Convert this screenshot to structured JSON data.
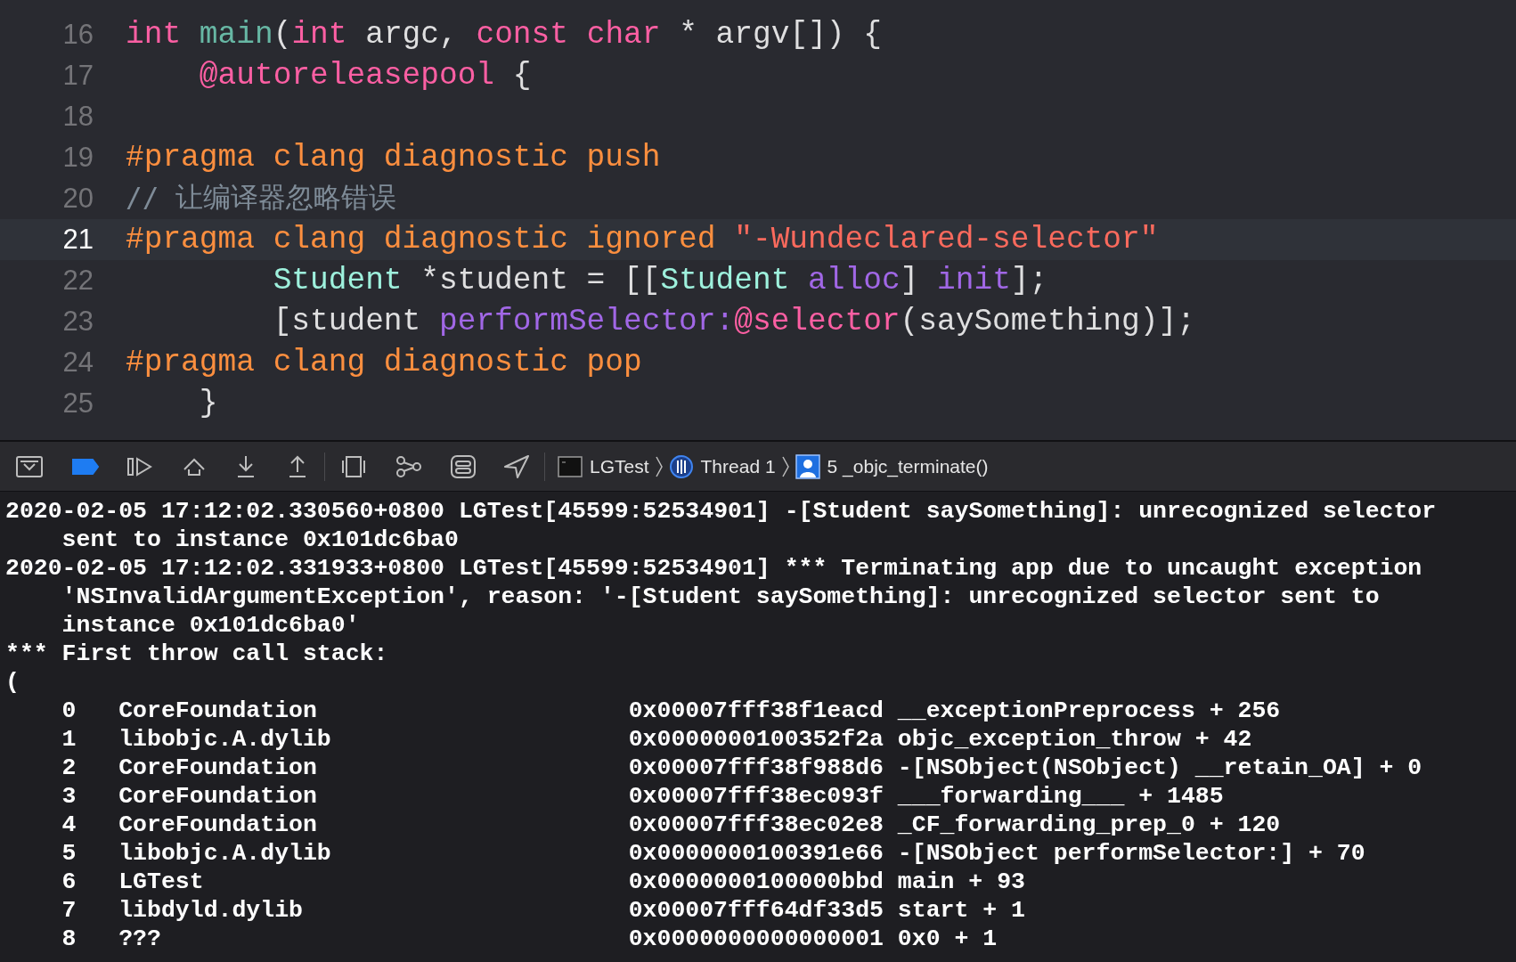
{
  "editor": {
    "lines": [
      {
        "number": "16",
        "current": false,
        "tokens": [
          {
            "kind": "keyword",
            "text": "int"
          },
          {
            "kind": "function",
            "text": " main"
          },
          {
            "kind": "plain",
            "text": "("
          },
          {
            "kind": "keyword",
            "text": "int"
          },
          {
            "kind": "plain",
            "text": " argc, "
          },
          {
            "kind": "keyword",
            "text": "const"
          },
          {
            "kind": "keyword",
            "text": " char"
          },
          {
            "kind": "plain",
            "text": " * argv[]) {"
          }
        ]
      },
      {
        "number": "17",
        "current": false,
        "tokens": [
          {
            "kind": "keyword",
            "text": "    @autoreleasepool"
          },
          {
            "kind": "plain",
            "text": " {"
          }
        ]
      },
      {
        "number": "18",
        "current": false
      },
      {
        "number": "19",
        "current": false,
        "tokens": [
          {
            "kind": "preprocessor",
            "text": "#pragma clang diagnostic push"
          }
        ]
      },
      {
        "number": "20",
        "current": false,
        "tokens": [
          {
            "kind": "comment",
            "text": "// 让编译器忽略错误"
          }
        ]
      },
      {
        "number": "21",
        "current": true,
        "tokens": [
          {
            "kind": "preprocessor",
            "text": "#pragma clang diagnostic ignored "
          },
          {
            "kind": "string",
            "text": "\"-Wundeclared-selector\""
          }
        ]
      },
      {
        "number": "22",
        "current": false,
        "tokens": [
          {
            "kind": "type",
            "text": "        Student"
          },
          {
            "kind": "plain",
            "text": " *student = [["
          },
          {
            "kind": "type",
            "text": "Student"
          },
          {
            "kind": "method",
            "text": " alloc"
          },
          {
            "kind": "plain",
            "text": "] "
          },
          {
            "kind": "method",
            "text": "init"
          },
          {
            "kind": "plain",
            "text": "];"
          }
        ]
      },
      {
        "number": "23",
        "current": false,
        "tokens": [
          {
            "kind": "plain",
            "text": "        [student "
          },
          {
            "kind": "method",
            "text": "performSelector:"
          },
          {
            "kind": "keyword",
            "text": "@selector"
          },
          {
            "kind": "plain",
            "text": "(saySomething)];"
          }
        ]
      },
      {
        "number": "24",
        "current": false,
        "tokens": [
          {
            "kind": "preprocessor",
            "text": "#pragma clang diagnostic pop"
          }
        ]
      },
      {
        "number": "25",
        "current": false,
        "tokens": [
          {
            "kind": "plain",
            "text": "    }"
          }
        ]
      }
    ]
  },
  "debug_bar": {
    "breakpoints_active": true,
    "breadcrumb": [
      {
        "kind": "process",
        "label": "LGTest"
      },
      {
        "kind": "thread",
        "label": "Thread 1"
      },
      {
        "kind": "frame",
        "label": "5 _objc_terminate()"
      }
    ]
  },
  "console": {
    "messages": [
      {
        "lines": [
          "2020-02-05 17:12:02.330560+0800 LGTest[45599:52534901] -[Student saySomething]: unrecognized selector",
          "sent to instance 0x101dc6ba0"
        ]
      },
      {
        "lines": [
          "2020-02-05 17:12:02.331933+0800 LGTest[45599:52534901] *** Terminating app due to uncaught exception",
          "'NSInvalidArgumentException', reason: '-[Student saySomething]: unrecognized selector sent to",
          "instance 0x101dc6ba0'"
        ]
      },
      {
        "lines": [
          "*** First throw call stack:"
        ]
      },
      {
        "lines": [
          "("
        ]
      }
    ],
    "frames": [
      {
        "index": "0",
        "library": "CoreFoundation",
        "address": "0x00007fff38f1eacd",
        "symbol": "__exceptionPreprocess + 256"
      },
      {
        "index": "1",
        "library": "libobjc.A.dylib",
        "address": "0x0000000100352f2a",
        "symbol": "objc_exception_throw + 42"
      },
      {
        "index": "2",
        "library": "CoreFoundation",
        "address": "0x00007fff38f988d6",
        "symbol": "-[NSObject(NSObject) __retain_OA] + 0"
      },
      {
        "index": "3",
        "library": "CoreFoundation",
        "address": "0x00007fff38ec093f",
        "symbol": "___forwarding___ + 1485"
      },
      {
        "index": "4",
        "library": "CoreFoundation",
        "address": "0x00007fff38ec02e8",
        "symbol": "_CF_forwarding_prep_0 + 120"
      },
      {
        "index": "5",
        "library": "libobjc.A.dylib",
        "address": "0x0000000100391e66",
        "symbol": "-[NSObject performSelector:] + 70"
      },
      {
        "index": "6",
        "library": "LGTest",
        "address": "0x0000000100000bbd",
        "symbol": "main + 93"
      },
      {
        "index": "7",
        "library": "libdyld.dylib",
        "address": "0x00007fff64df33d5",
        "symbol": "start + 1"
      },
      {
        "index": "8",
        "library": "???",
        "address": "0x0000000000000001",
        "symbol": "0x0 + 1"
      }
    ]
  }
}
